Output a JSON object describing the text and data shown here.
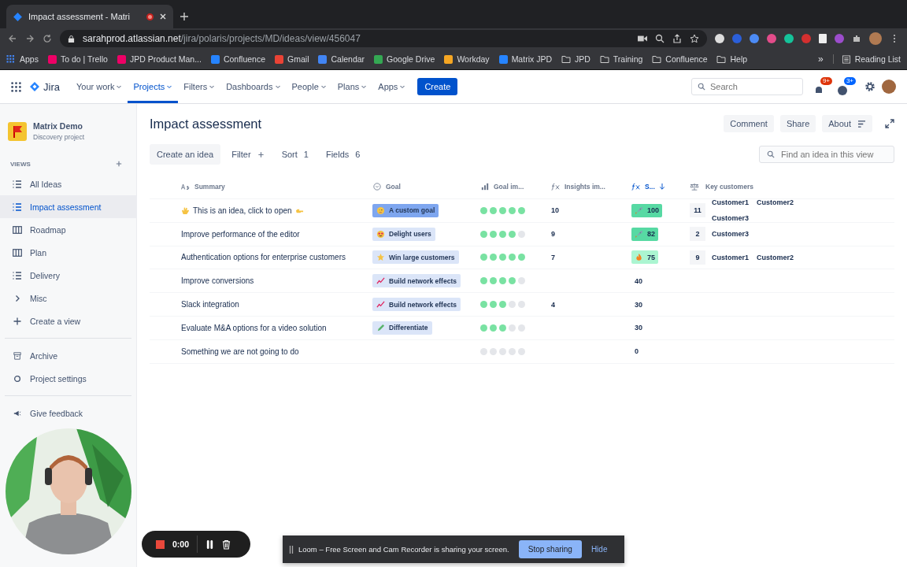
{
  "browser": {
    "tab_title": "Impact assessment - Matri",
    "url_host": "sarahprod.atlassian.net",
    "url_path": "/jira/polaris/projects/MD/ideas/view/456047",
    "bookmarks": [
      {
        "label": "Apps",
        "kind": "grid"
      },
      {
        "label": "To do | Trello",
        "kind": "trello"
      },
      {
        "label": "JPD Product Man...",
        "kind": "trello"
      },
      {
        "label": "Confluence",
        "kind": "confluence"
      },
      {
        "label": "Gmail",
        "kind": "gmail"
      },
      {
        "label": "Calendar",
        "kind": "calendar"
      },
      {
        "label": "Google Drive",
        "kind": "drive"
      },
      {
        "label": "Workday",
        "kind": "workday"
      },
      {
        "label": "Matrix JPD",
        "kind": "jira"
      },
      {
        "label": "JPD",
        "kind": "folder"
      },
      {
        "label": "Training",
        "kind": "folder"
      },
      {
        "label": "Confluence",
        "kind": "folder"
      },
      {
        "label": "Help",
        "kind": "folder"
      }
    ],
    "more": "»",
    "reading_list": "Reading List"
  },
  "topnav": {
    "product": "Jira",
    "items": [
      {
        "label": "Your work",
        "selected": false
      },
      {
        "label": "Projects",
        "selected": true
      },
      {
        "label": "Filters",
        "selected": false
      },
      {
        "label": "Dashboards",
        "selected": false
      },
      {
        "label": "People",
        "selected": false
      },
      {
        "label": "Plans",
        "selected": false
      },
      {
        "label": "Apps",
        "selected": false
      }
    ],
    "create": "Create",
    "search_placeholder": "Search",
    "notifications": "9+",
    "help": "3+"
  },
  "sidebar": {
    "project": "Matrix Demo",
    "project_type": "Discovery project",
    "views_heading": "VIEWS",
    "views": [
      {
        "label": "All Ideas",
        "kind": "list",
        "selected": false
      },
      {
        "label": "Impact assessment",
        "kind": "list",
        "selected": true
      },
      {
        "label": "Roadmap",
        "kind": "board",
        "selected": false
      },
      {
        "label": "Plan",
        "kind": "board",
        "selected": false
      },
      {
        "label": "Delivery",
        "kind": "list",
        "selected": false
      },
      {
        "label": "Misc",
        "kind": "folder",
        "selected": false
      }
    ],
    "create_view": "Create a view",
    "archive": "Archive",
    "settings": "Project settings",
    "feedback": "Give feedback"
  },
  "page": {
    "title": "Impact assessment",
    "actions": [
      "Comment",
      "Share",
      "About"
    ],
    "toolbar": {
      "create": "Create an idea",
      "filter": "Filter",
      "sort": "Sort",
      "sort_count": "1",
      "fields": "Fields",
      "fields_count": "6"
    },
    "search_placeholder": "Find an idea in this view"
  },
  "table": {
    "columns": [
      "Summary",
      "Goal",
      "Goal im...",
      "Insights im...",
      "S...",
      "Key customers"
    ],
    "rows": [
      {
        "summary": "This is an idea, click to open",
        "hands": true,
        "goal": {
          "label": "A custom goal",
          "kind": "thinking",
          "selected": true
        },
        "stars": 5,
        "insights": "10",
        "score": {
          "value": "100",
          "kind": "rocket",
          "color": "#57d9a3"
        },
        "customer_count": "11",
        "customers": [
          "Customer1",
          "Customer2",
          "Customer3"
        ]
      },
      {
        "summary": "Improve performance of the editor",
        "hands": false,
        "goal": {
          "label": "Delight users",
          "kind": "heart-eyes",
          "selected": false
        },
        "stars": 4,
        "insights": "9",
        "score": {
          "value": "82",
          "kind": "rocket",
          "color": "#57d9a3"
        },
        "customer_count": "2",
        "customers": [
          "Customer3"
        ]
      },
      {
        "summary": "Authentication options for enterprise customers",
        "hands": false,
        "goal": {
          "label": "Win large customers",
          "kind": "star",
          "selected": false
        },
        "stars": 5,
        "insights": "7",
        "score": {
          "value": "75",
          "kind": "fire",
          "color": "#abf5d1"
        },
        "customer_count": "9",
        "customers": [
          "Customer1",
          "Customer2"
        ]
      },
      {
        "summary": "Improve conversions",
        "hands": false,
        "goal": {
          "label": "Build network effects",
          "kind": "chart",
          "selected": false
        },
        "stars": 4,
        "score": {
          "value": "40"
        }
      },
      {
        "summary": "Slack integration",
        "hands": false,
        "goal": {
          "label": "Build network effects",
          "kind": "chart",
          "selected": false
        },
        "stars": 3,
        "insights": "4",
        "score": {
          "value": "30"
        }
      },
      {
        "summary": "Evaluate M&A options for a video solution",
        "hands": false,
        "goal": {
          "label": "Differentiate",
          "kind": "pencil",
          "selected": false
        },
        "stars": 3,
        "score": {
          "value": "30"
        }
      },
      {
        "summary": "Something we are not going to do",
        "hands": false,
        "stars": 0,
        "score": {
          "value": "0"
        }
      }
    ]
  },
  "recorder": {
    "time": "0:00"
  },
  "share_bar": {
    "message": "Loom – Free Screen and Cam Recorder is sharing your screen.",
    "stop": "Stop sharing",
    "hide": "Hide"
  }
}
